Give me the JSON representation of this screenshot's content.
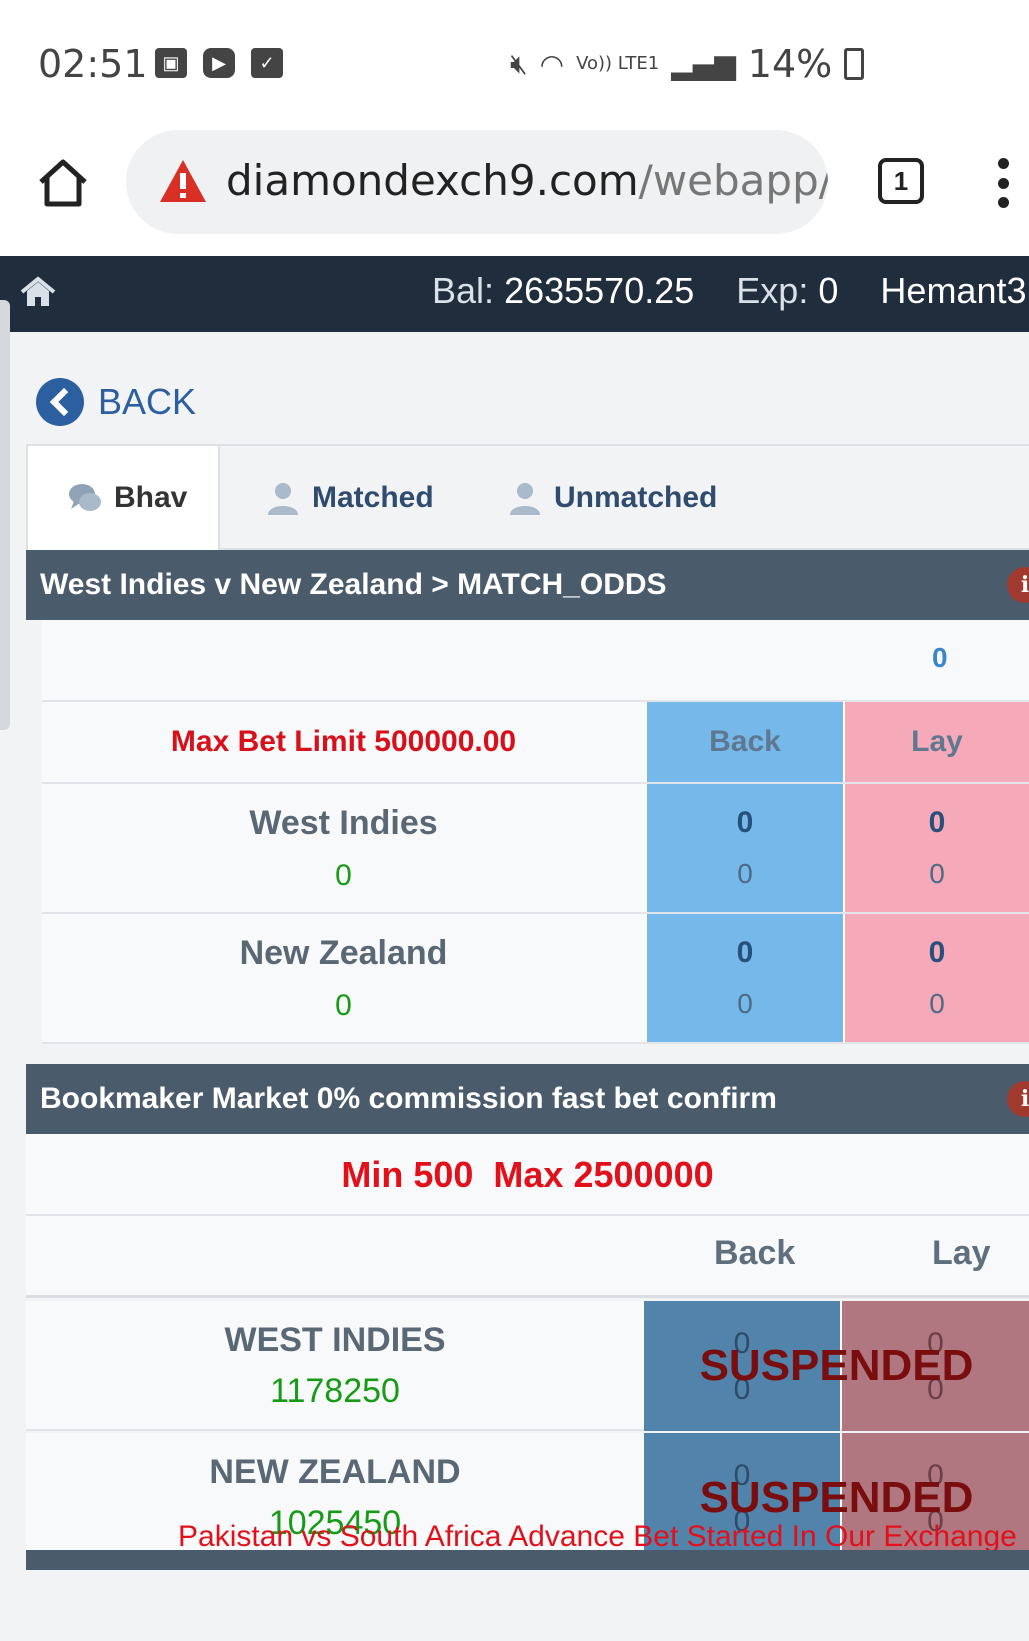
{
  "status_bar": {
    "time": "02:51",
    "network": "Vo)) LTE1",
    "battery": "14%"
  },
  "browser": {
    "url_domain": "diamondexch9.com",
    "url_rest": "/webapp/b",
    "tab_count": "1"
  },
  "header": {
    "bal_label": "Bal:",
    "bal_value": "2635570.25",
    "exp_label": "Exp:",
    "exp_value": "0",
    "user": "Hemant3"
  },
  "back_label": "BACK",
  "tabs": [
    {
      "label": "Bhav",
      "icon": "chat-bubbles-icon",
      "active": true
    },
    {
      "label": "Matched",
      "icon": "user-icon",
      "active": false
    },
    {
      "label": "Unmatched",
      "icon": "user-icon",
      "active": false
    }
  ],
  "match_odds": {
    "title": "West Indies v New Zealand > MATCH_ODDS",
    "top_value": "0",
    "max_bet": "Max Bet Limit 500000.00",
    "back_label": "Back",
    "lay_label": "Lay",
    "runners": [
      {
        "name": "West Indies",
        "position": "0",
        "back_odd": "0",
        "back_size": "0",
        "lay_odd": "0",
        "lay_size": "0"
      },
      {
        "name": "New Zealand",
        "position": "0",
        "back_odd": "0",
        "back_size": "0",
        "lay_odd": "0",
        "lay_size": "0"
      }
    ]
  },
  "bookmaker": {
    "title": "Bookmaker Market 0% commission fast bet confirm",
    "limits": "Min 500  Max 2500000",
    "back_label": "Back",
    "lay_label": "Lay",
    "runners": [
      {
        "name": "WEST INDIES",
        "position": "1178250",
        "back_odd": "0",
        "back_size": "0",
        "lay_odd": "0",
        "lay_size": "0",
        "status": "SUSPENDED"
      },
      {
        "name": "NEW ZEALAND",
        "position": "1025450",
        "back_odd": "0",
        "back_size": "0",
        "lay_odd": "0",
        "lay_size": "0",
        "status": "SUSPENDED"
      }
    ]
  },
  "ticker": "Pakistan vs South Africa Advance Bet Started In Our Exchange",
  "colors": {
    "header_bg": "#1f2d3d",
    "section_bg": "#4a5b6c",
    "back_blue": "#75b9ea",
    "lay_pink": "#f5a9b9",
    "suspended_back": "#5283ab",
    "suspended_lay": "#b07781",
    "alert_red": "#e1101a",
    "positive_green": "#179b17"
  }
}
